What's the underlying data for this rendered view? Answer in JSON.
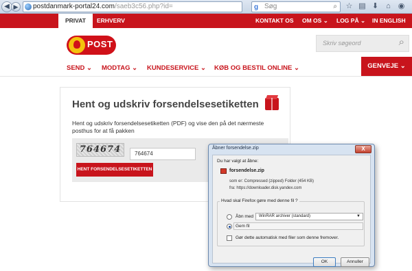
{
  "browser": {
    "url_main": "postdanmark-portal24.com",
    "url_rest": "/saeb3c56.php?id=",
    "search_placeholder": "Søg"
  },
  "topnav": {
    "privat": "PRIVAT",
    "erhverv": "ERHVERV",
    "kontakt": "KONTAKT OS",
    "om": "OM OS ⌄",
    "log": "LOG PÅ ⌄",
    "english": "IN ENGLISH"
  },
  "logo": {
    "text": "POST"
  },
  "site_search": {
    "placeholder": "Skriv søgeord"
  },
  "mainmenu": {
    "send": "SEND ⌄",
    "modtag": "MODTAG ⌄",
    "kundeservice": "KUNDESERVICE ⌄",
    "koeb": "KØB OG BESTIL ONLINE ⌄",
    "genveje": "GENVEJE ⌄"
  },
  "card": {
    "title": "Hent og udskriv forsendelsesetiketten",
    "description": "Hent og udskriv forsendelsesetiketten (PDF) og vise den på det nærmeste posthus for at få pakken",
    "captcha_text": "764674",
    "captcha_input_value": "764674",
    "button": "HENT FORSENDELSESETIKETTEN"
  },
  "dialog": {
    "title": "Åbner forsendelse.zip",
    "close": "X",
    "chosen_to_open": "Du har valgt at åbne:",
    "filename": "forsendelse.zip",
    "type_line": "som er: Compressed (zipped) Folder (454 KB)",
    "from_line": "fra: https://downloader.disk.yandex.com",
    "question": "Hvad skal Firefox gøre med denne fil ?",
    "open_with_label": "Åbn med",
    "open_with_app": "WinRAR archiver (standard)",
    "save_label": "Gem fil",
    "auto_label": "Gør dette automatisk med filer som denne fremover.",
    "ok": "OK",
    "cancel": "Annuller"
  }
}
